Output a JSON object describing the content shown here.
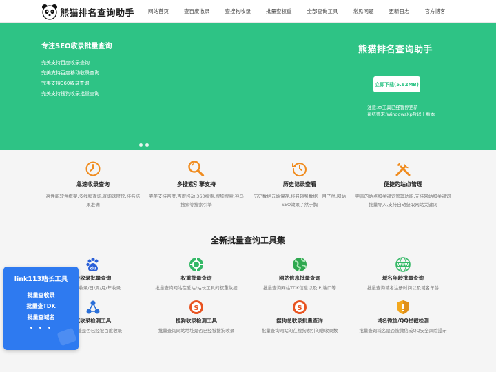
{
  "header": {
    "logo_text": "熊猫排名查询助手",
    "nav": [
      "网站首页",
      "查百度收录",
      "查搜狗收录",
      "批量查权重",
      "全部查询工具",
      "常见问题",
      "更新日志",
      "官方博客"
    ]
  },
  "banner": {
    "title": "专注SEO收录批量查询",
    "items": [
      "完美支持百度收录查询",
      "完美支持百度移动收录查询",
      "完美支持360收录查询",
      "完美支持搜狗收录批量查询"
    ],
    "app_title": "熊猫排名查询助手",
    "download_label": "立即下载(5.82MB)",
    "note_line1": "注意:本工具已经暂停更新",
    "note_line2": "系统要求:WindowsXp及以上版本"
  },
  "features": [
    {
      "icon": "clock-icon",
      "title": "急速收录查询",
      "desc": "高性能软件框架,多线程查询,查询速度快,排名结果准确"
    },
    {
      "icon": "magnifier-icon",
      "title": "多搜索引擎支持",
      "desc": "完美支持百度,百度移动,360搜索,搜狗搜索,神马搜索等搜索引擎"
    },
    {
      "icon": "history-icon",
      "title": "历史记录查看",
      "desc": "历史数据云端保存,排名趋势数据一目了然,网站SEO效果了然于胸"
    },
    {
      "icon": "tools-icon",
      "title": "便捷的站点管理",
      "desc": "完善的站点和关键词管理功能,支持网站和关键词批量导入,支持自动获取网站关键词"
    }
  ],
  "tools_title": "全新批量查询工具集",
  "tools": [
    {
      "icon": "baidu-paw-icon",
      "title": "度收录批量查询",
      "desc": "百度总收录/日/周/月/年收录"
    },
    {
      "icon": "weight-icon",
      "title": "权重批量查询",
      "desc": "批量查询网站在爱站/站长工具的权重数据"
    },
    {
      "icon": "globe-icon",
      "title": "网站信息批量查询",
      "desc": "批量查询网站TDK信息以及IP,端口等"
    },
    {
      "icon": "www-globe-icon",
      "title": "域名年龄批量查询",
      "desc": "批量查询域名注册时间以及域名年龄"
    },
    {
      "icon": "share-network-icon",
      "title": "度收录检测工具",
      "desc": "检测网址是否已经被百度收录"
    },
    {
      "icon": "sogou-icon",
      "title": "搜狗收录检测工具",
      "desc": "批量查询网站地址是否已经被搜狗收录"
    },
    {
      "icon": "sogou-icon",
      "title": "搜狗总收录批量查询",
      "desc": "批量查询网站的在搜狗索引的总收录数"
    },
    {
      "icon": "shield-icon",
      "title": "域名微信/QQ拦截检测",
      "desc": "批量查询域名是否被微信或QQ安全风险提示"
    }
  ],
  "float_widget": {
    "title": "link113站长工具",
    "links": [
      "批量查收录",
      "批量查TDK",
      "批量查域名"
    ],
    "more": "• • •"
  },
  "colors": {
    "brand_green": "#2ec385",
    "accent_orange": "#f08c1f",
    "widget_blue": "#2e7af0"
  }
}
